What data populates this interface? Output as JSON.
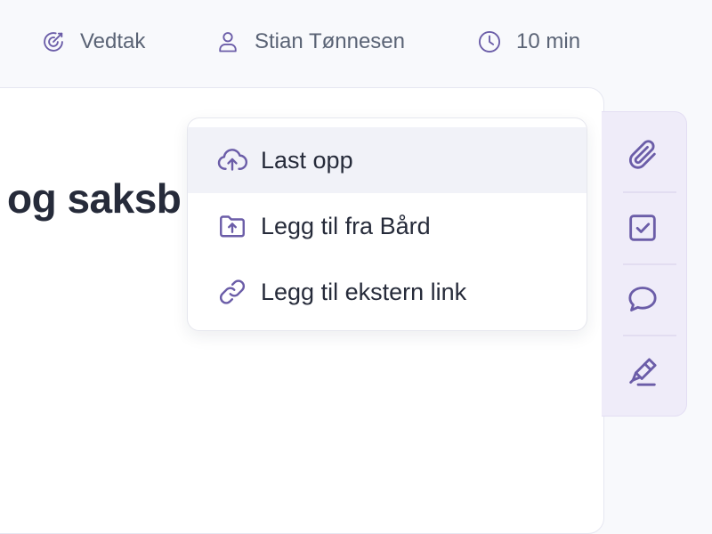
{
  "meta": {
    "type_label": "Vedtak",
    "assignee_name": "Stian Tønnesen",
    "duration": "10 min"
  },
  "document": {
    "title_visible": "og saksb"
  },
  "add_menu": {
    "items": [
      {
        "label": "Last opp",
        "icon": "cloud-upload-icon",
        "highlighted": true
      },
      {
        "label": "Legg til fra Bård",
        "icon": "folder-upload-icon"
      },
      {
        "label": "Legg til ekstern link",
        "icon": "link-icon"
      }
    ]
  },
  "tool_rail": {
    "tools": [
      {
        "icon": "paperclip-icon"
      },
      {
        "icon": "checkbox-icon"
      },
      {
        "icon": "chat-bubble-icon"
      },
      {
        "icon": "signature-pen-icon"
      }
    ]
  },
  "colors": {
    "accent": "#6b5da8",
    "rail_background": "#efecf9",
    "text": "#262b3a",
    "muted_text": "#5a6375",
    "highlight": "#f1f2f8"
  }
}
